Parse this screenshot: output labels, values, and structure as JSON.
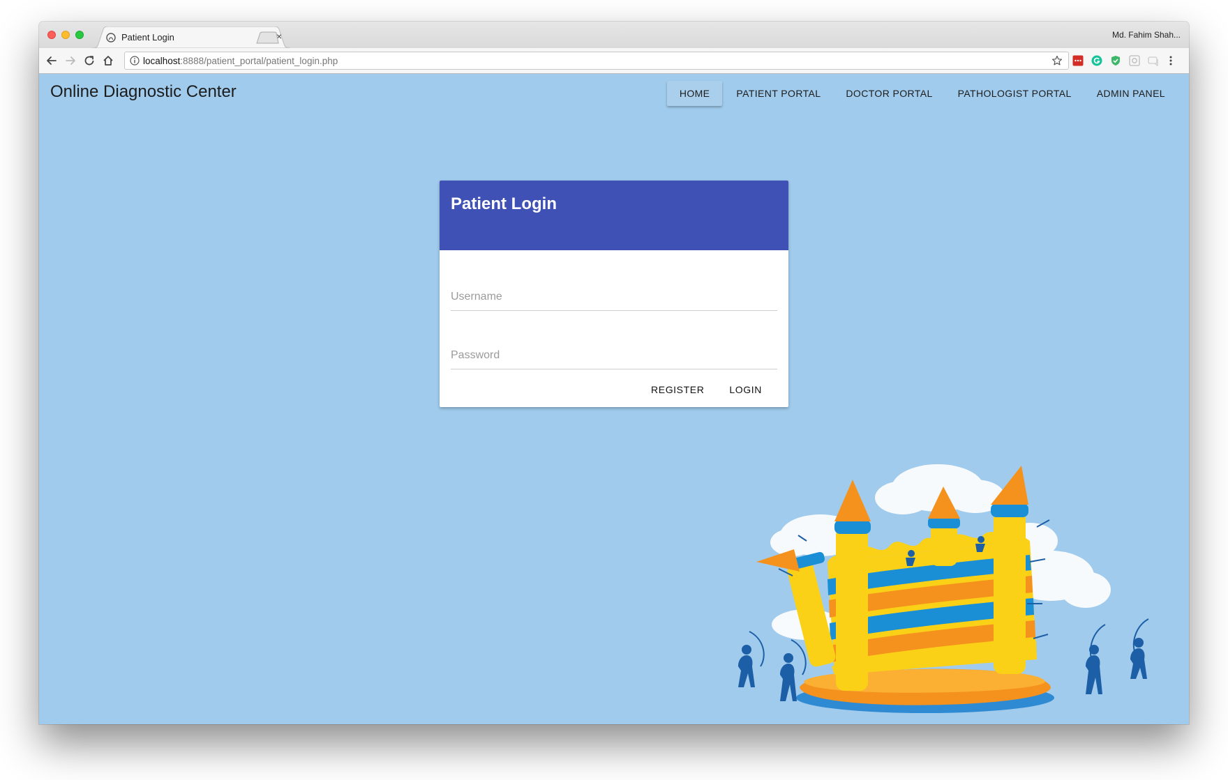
{
  "browser": {
    "tab_title": "Patient Login",
    "profile_name": "Md. Fahim Shah...",
    "url_host": "localhost",
    "url_rest": ":8888/patient_portal/patient_login.php",
    "extensions": [
      "lastpass-icon",
      "grammarly-icon",
      "shield-extension-icon",
      "extension-grid-icon",
      "extension-cast-icon"
    ]
  },
  "navbar": {
    "brand": "Online Diagnostic Center",
    "links": [
      {
        "label": "HOME",
        "active": true
      },
      {
        "label": "PATIENT PORTAL"
      },
      {
        "label": "DOCTOR PORTAL"
      },
      {
        "label": "PATHOLOGIST PORTAL"
      },
      {
        "label": "ADMIN PANEL"
      }
    ]
  },
  "login": {
    "title": "Patient Login",
    "username_placeholder": "Username",
    "password_placeholder": "Password",
    "register_label": "REGISTER",
    "login_label": "LOGIN"
  },
  "colors": {
    "page_background": "#a0cbec",
    "card_header": "#3f51b5",
    "castle_yellow": "#fbd117",
    "castle_orange": "#f5921e",
    "castle_blue": "#1a8fd6",
    "archer_blue": "#1c5fa6"
  }
}
